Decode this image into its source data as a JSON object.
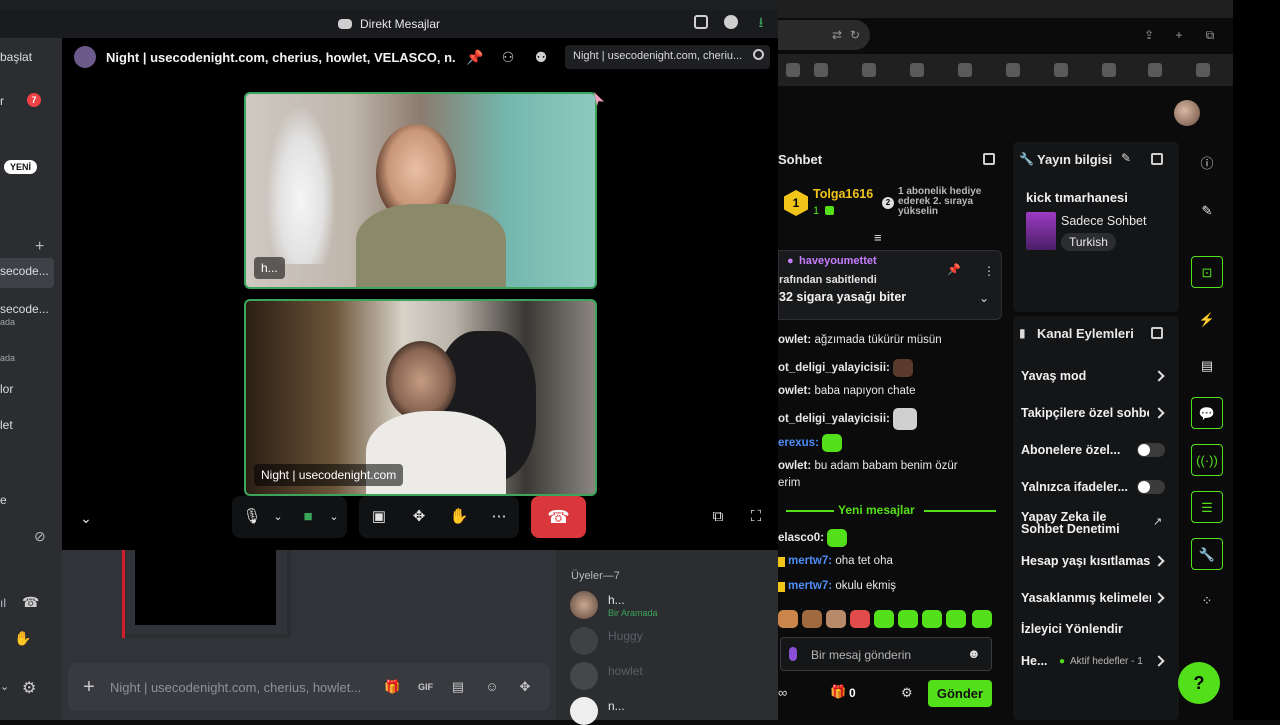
{
  "discord": {
    "window_title": "Direkt Mesajlar",
    "sidebar": {
      "start_label": "başlat",
      "badge_count": "7",
      "new_badge": "YENİ",
      "items": [
        {
          "label": "secode...",
          "sub": ""
        },
        {
          "label": "secode...",
          "sub": "ada"
        },
        {
          "label": "",
          "sub": "ada"
        },
        {
          "label": "lor",
          "sub": ""
        },
        {
          "label": "let",
          "sub": ""
        },
        {
          "label": "e",
          "sub": ""
        }
      ]
    },
    "group_title": "Night | usecodenight.com, cherius, howlet, VELASCO, n..., Hu",
    "search_placeholder": "Night | usecodenight.com, cheriu...",
    "tiles": [
      {
        "label": "h..."
      },
      {
        "label": "Night | usecodenight.com"
      }
    ],
    "message_placeholder": "Night | usecodenight.com, cherius, howlet...",
    "members": {
      "header": "Üyeler—7",
      "list": [
        {
          "name": "h...",
          "status": "Bir Aramada",
          "dim": false
        },
        {
          "name": "Huggy",
          "status": "",
          "dim": true
        },
        {
          "name": "howlet",
          "status": "",
          "dim": true
        },
        {
          "name": "n...",
          "status": "",
          "dim": false
        }
      ]
    }
  },
  "kick": {
    "chat_title": "Sohbet",
    "top_sub": {
      "user": "Tolga1616",
      "rank": "1",
      "count": "1",
      "gift_number": "2",
      "gift_text": "1 abonelik hediye ederek 2. sıraya yükselin"
    },
    "pinned": {
      "user": "haveyoumettet",
      "by_text": "rafından sabitlendi",
      "message": "32 sigara yasağı biter"
    },
    "messages": [
      {
        "user": "owlet:",
        "text": "ağzımada tükürür müsün",
        "color": "#e8e8e8"
      },
      {
        "user": "ot_deligi_yalayicisii:",
        "text": "",
        "color": "#e8e8e8"
      },
      {
        "user": "owlet:",
        "text": "baba napıyon chate",
        "color": "#e8e8e8"
      },
      {
        "user": "ot_deligi_yalayicisii:",
        "text": "",
        "color": "#e8e8e8"
      },
      {
        "user": "erexus:",
        "text": "",
        "color": "#4f8df7"
      },
      {
        "user": "owlet:",
        "text": "bu adam babam benim özür",
        "color": "#e8e8e8"
      },
      {
        "user": "",
        "text": "erim",
        "color": "#e8e8e8"
      }
    ],
    "new_messages": "Yeni mesajlar",
    "after_messages": [
      {
        "user": "elasco0:",
        "text": "",
        "color": "#e8e8e8"
      },
      {
        "user": "mertw7:",
        "text": "oha tet oha",
        "color": "#4f8df7"
      },
      {
        "user": "mertw7:",
        "text": "okulu ekmiş",
        "color": "#4f8df7"
      }
    ],
    "input_placeholder": "Bir mesaj gönderin",
    "bottom": {
      "gift_count": "0",
      "send_label": "Gönder"
    },
    "stream_info": {
      "title": "Yayın bilgisi",
      "stream_name": "kick tımarhanesi",
      "category": "Sadece Sohbet",
      "language": "Turkish"
    },
    "channel_actions": {
      "title": "Kanal Eylemleri",
      "items": [
        {
          "label": "Yavaş mod",
          "kind": "chevron"
        },
        {
          "label": "Takipçilere özel sohbet",
          "kind": "chevron"
        },
        {
          "label": "Abonelere özel...",
          "kind": "toggle"
        },
        {
          "label": "Yalnızca ifadeler...",
          "kind": "toggle"
        },
        {
          "label": "Yapay Zeka ile Sohbet Denetimi",
          "kind": "external"
        },
        {
          "label": "Hesap yaşı kısıtlaması",
          "kind": "chevron"
        },
        {
          "label": "Yasaklanmış kelimeler",
          "kind": "chevron"
        },
        {
          "label": "İzleyici Yönlendir",
          "kind": "none"
        },
        {
          "label": "He...",
          "kind": "chevron"
        }
      ],
      "goals_status": "Aktif hedefler - 1"
    }
  },
  "colors": {
    "kick_green": "#53e01a",
    "discord_green": "#3ba55c",
    "end_call_red": "#da373c"
  }
}
